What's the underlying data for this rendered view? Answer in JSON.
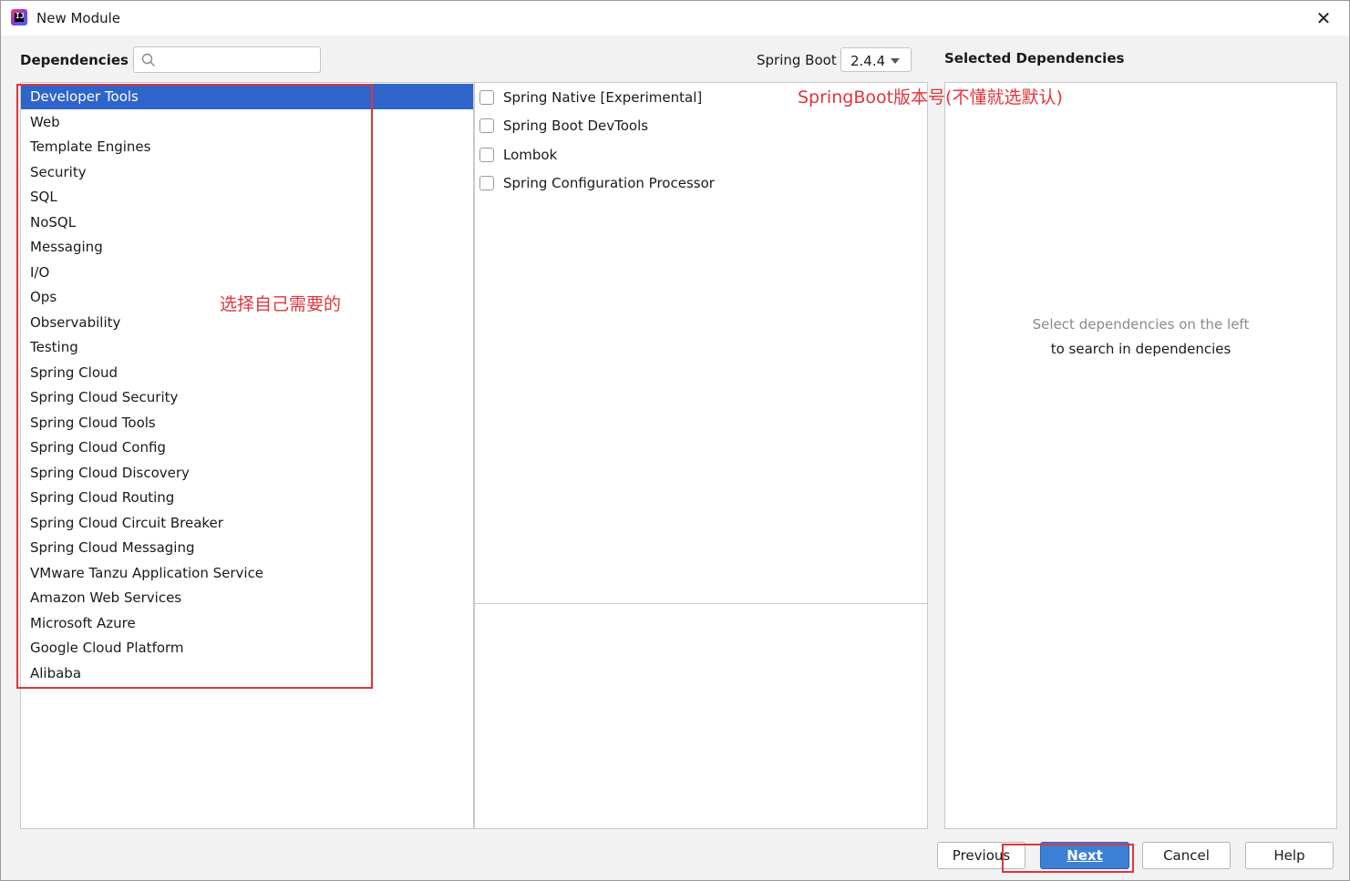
{
  "window": {
    "title": "New Module",
    "app_icon_text": "IJ"
  },
  "header": {
    "dependencies_label": "Dependencies",
    "search_placeholder": "",
    "spring_boot_label": "Spring Boot",
    "spring_boot_version": "2.4.4",
    "selected_dependencies_label": "Selected Dependencies"
  },
  "categories": [
    "Developer Tools",
    "Web",
    "Template Engines",
    "Security",
    "SQL",
    "NoSQL",
    "Messaging",
    "I/O",
    "Ops",
    "Observability",
    "Testing",
    "Spring Cloud",
    "Spring Cloud Security",
    "Spring Cloud Tools",
    "Spring Cloud Config",
    "Spring Cloud Discovery",
    "Spring Cloud Routing",
    "Spring Cloud Circuit Breaker",
    "Spring Cloud Messaging",
    "VMware Tanzu Application Service",
    "Amazon Web Services",
    "Microsoft Azure",
    "Google Cloud Platform",
    "Alibaba"
  ],
  "selected_category": "Developer Tools",
  "dependencies": [
    "Spring Native [Experimental]",
    "Spring Boot DevTools",
    "Lombok",
    "Spring Configuration Processor"
  ],
  "selected_panel": {
    "empty_line1": "Select dependencies on the left",
    "empty_line2": "to search in dependencies"
  },
  "buttons": {
    "previous": "Previous",
    "next": "Next",
    "cancel": "Cancel",
    "help": "Help"
  },
  "annotations": {
    "choose_text": "选择自己需要的",
    "version_text": "SpringBoot版本号(不懂就选默认)"
  },
  "colors": {
    "selection": "#2f65ca",
    "primary_button": "#3c7fd6",
    "annotation": "#e0353b"
  }
}
